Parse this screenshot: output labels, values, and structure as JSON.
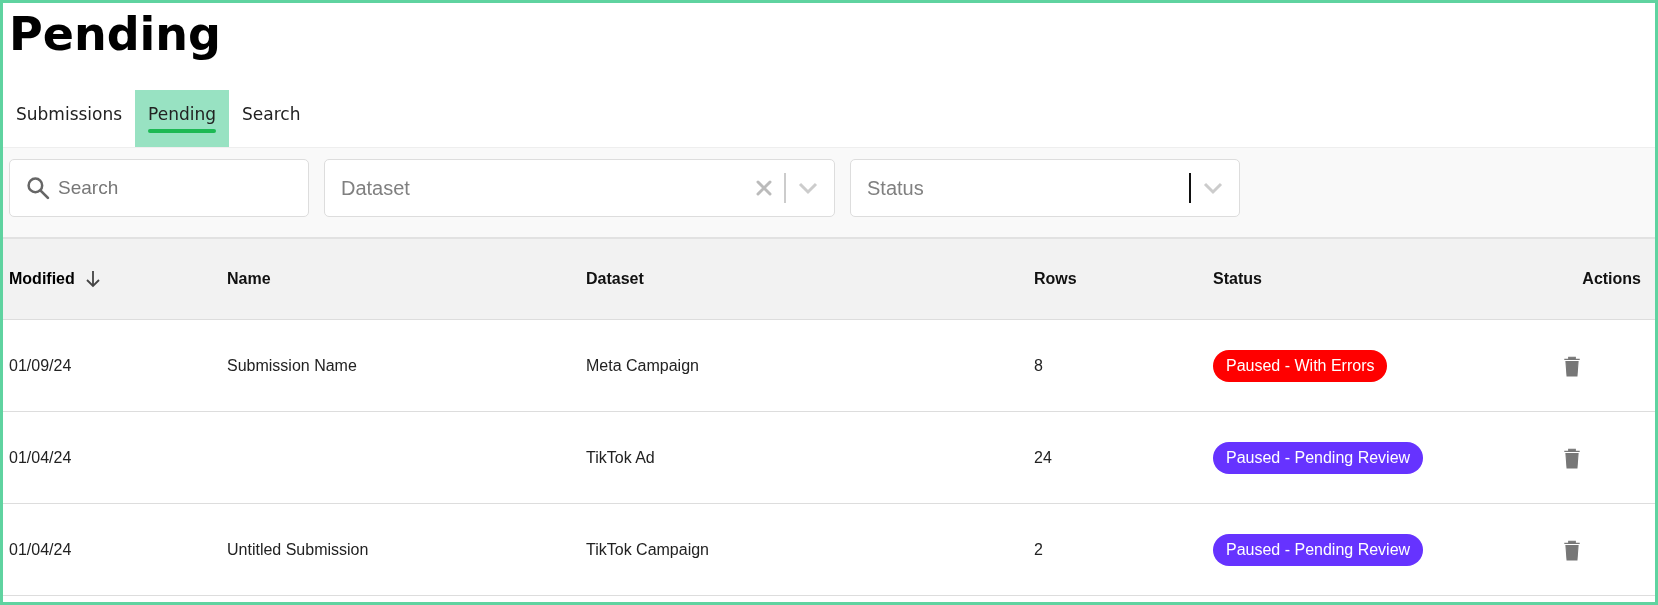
{
  "page": {
    "title": "Pending"
  },
  "tabs": [
    {
      "label": "Submissions",
      "selected": false
    },
    {
      "label": "Pending",
      "selected": true
    },
    {
      "label": "Search",
      "selected": false
    }
  ],
  "filters": {
    "search": {
      "placeholder": "Search"
    },
    "dataset": {
      "placeholder": "Dataset"
    },
    "status": {
      "placeholder": "Status"
    }
  },
  "table": {
    "columns": [
      {
        "label": "Modified",
        "sorted": true
      },
      {
        "label": "Name",
        "sorted": false
      },
      {
        "label": "Dataset",
        "sorted": false
      },
      {
        "label": "Rows",
        "sorted": false
      },
      {
        "label": "Status",
        "sorted": false
      },
      {
        "label": "Actions",
        "sorted": false
      }
    ],
    "rows": [
      {
        "modified": "01/09/24",
        "name": "Submission Name",
        "dataset": "Meta Campaign",
        "rows": "8",
        "status": {
          "label": "Paused - With Errors",
          "color": "#ff0000"
        }
      },
      {
        "modified": "01/04/24",
        "dataset": "TikTok Ad",
        "rows": "24",
        "status": {
          "label": "Paused - Pending Review",
          "color": "#6633ff"
        }
      },
      {
        "modified": "01/04/24",
        "name": "Untitled Submission",
        "dataset": "TikTok Campaign",
        "rows": "2",
        "status": {
          "label": "Paused - Pending Review",
          "color": "#6633ff"
        }
      }
    ]
  }
}
